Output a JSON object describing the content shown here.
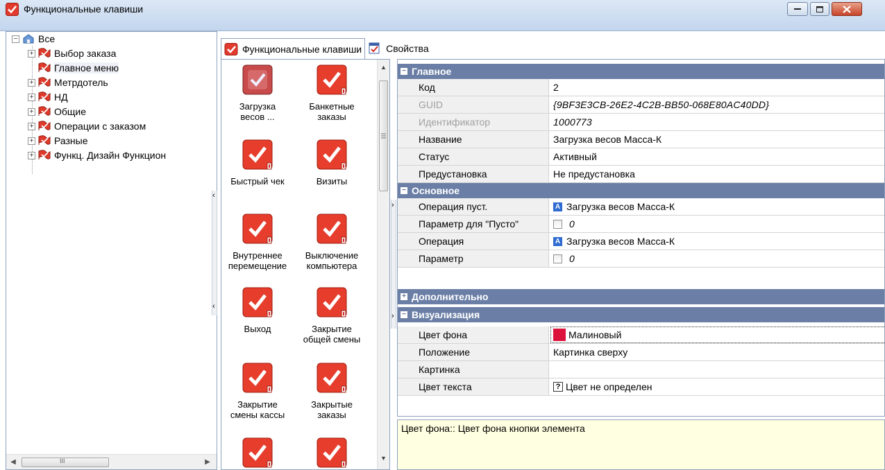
{
  "window": {
    "title": "Функциональные клавиши"
  },
  "tree": {
    "root": "Все",
    "items": [
      {
        "label": "Выбор заказа",
        "expandable": true
      },
      {
        "label": "Главное меню",
        "expandable": false,
        "selected": true
      },
      {
        "label": "Метрдотель",
        "expandable": true
      },
      {
        "label": "НД",
        "expandable": true
      },
      {
        "label": "Общие",
        "expandable": true
      },
      {
        "label": "Операции с заказом",
        "expandable": true
      },
      {
        "label": "Разные",
        "expandable": true
      },
      {
        "label": "Функц. Дизайн Функцион",
        "expandable": true
      }
    ],
    "scroll_grip": "III"
  },
  "tabs": [
    {
      "label": "Функциональные клавиши",
      "active": true
    },
    {
      "label": "Свойства",
      "active": false
    }
  ],
  "keys": [
    {
      "label": "Загрузка весов ...",
      "line1": "Загрузка",
      "line2": "весов ...",
      "style": "selected"
    },
    {
      "label": "Банкетные заказы",
      "line1": "Банкетные",
      "line2": "заказы"
    },
    {
      "label": "Быстрый чек",
      "line1": "Быстрый чек",
      "line2": ""
    },
    {
      "label": "Визиты",
      "line1": "Визиты",
      "line2": ""
    },
    {
      "label": "Внутреннее перемещение",
      "line1": "Внутреннее",
      "line2": "перемещение"
    },
    {
      "label": "Выключение компьютера",
      "line1": "Выключение",
      "line2": "компьютера"
    },
    {
      "label": "Выход",
      "line1": "Выход",
      "line2": ""
    },
    {
      "label": "Закрытие общей смены",
      "line1": "Закрытие",
      "line2": "общей смены"
    },
    {
      "label": "Закрытие смены кассы",
      "line1": "Закрытие",
      "line2": "смены кассы"
    },
    {
      "label": "Закрытые заказы",
      "line1": "Закрытые",
      "line2": "заказы"
    },
    {
      "label": "",
      "line1": "",
      "line2": ""
    },
    {
      "label": "",
      "line1": "",
      "line2": ""
    }
  ],
  "properties": {
    "sections": {
      "main": "Главное",
      "basic": "Основное",
      "extra": "Дополнительно",
      "visual": "Визуализация"
    },
    "main": {
      "code_label": "Код",
      "code": "2",
      "guid_label": "GUID",
      "guid": "{9BF3E3CB-26E2-4C2B-BB50-068E80AC40DD}",
      "id_label": "Идентификатор",
      "id": "1000773",
      "name_label": "Название",
      "name": "Загрузка весов Масса-К",
      "status_label": "Статус",
      "status": "Активный",
      "preset_label": "Предустановка",
      "preset": "Не предустановка"
    },
    "basic": {
      "op_empty_label": "Операция пуст.",
      "op_empty": "Загрузка весов Масса-К",
      "param_empty_label": "Параметр для \"Пусто\"",
      "param_empty": "0",
      "op_label": "Операция",
      "op": "Загрузка весов Масса-К",
      "param_label": "Параметр",
      "param": "0"
    },
    "visual": {
      "bg_label": "Цвет фона",
      "bg": "Малиновый",
      "bg_color": "#DC143C",
      "position_label": "Положение",
      "position": "Картинка сверху",
      "picture_label": "Картинка",
      "picture": "",
      "text_color_label": "Цвет текста",
      "text_color": "Цвет не определен"
    }
  },
  "description": "Цвет фона:: Цвет фона кнопки элемента",
  "icons": {
    "app": "red-check-icon",
    "tree_node": "red-flag-icon",
    "properties_tab": "properties-icon"
  }
}
